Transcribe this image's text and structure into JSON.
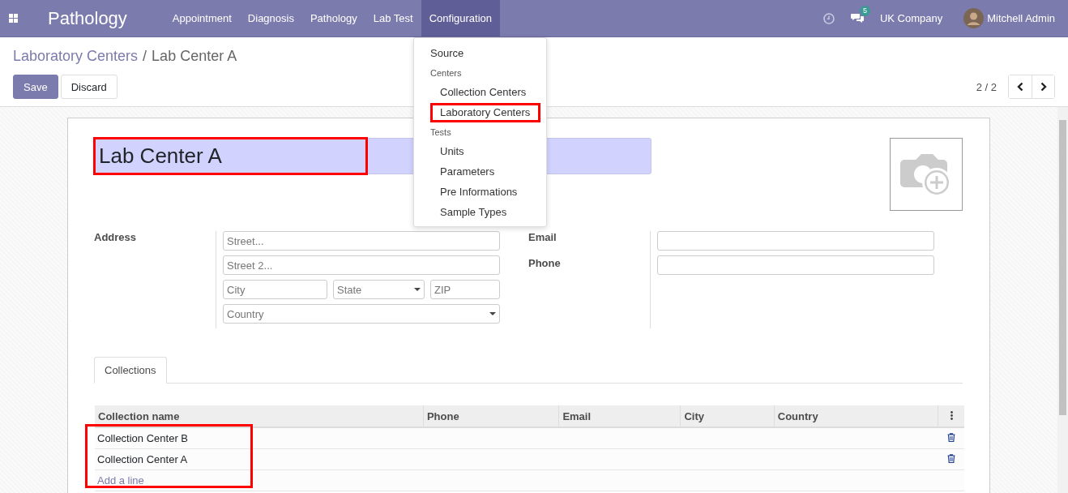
{
  "navbar": {
    "app_title": "Pathology",
    "menu": [
      {
        "label": "Appointment",
        "selected": false
      },
      {
        "label": "Diagnosis",
        "selected": false
      },
      {
        "label": "Pathology",
        "selected": false
      },
      {
        "label": "Lab Test",
        "selected": false
      },
      {
        "label": "Configuration",
        "selected": true
      }
    ],
    "messages_badge": "5",
    "company": "UK Company",
    "user": "Mitchell Admin"
  },
  "config_menu": {
    "items": [
      {
        "kind": "item",
        "label": "Source",
        "highlighted": false
      },
      {
        "kind": "header",
        "label": "Centers"
      },
      {
        "kind": "subitem",
        "label": "Collection Centers",
        "highlighted": false
      },
      {
        "kind": "subitem",
        "label": "Laboratory Centers",
        "highlighted": true
      },
      {
        "kind": "header",
        "label": "Tests"
      },
      {
        "kind": "subitem",
        "label": "Units",
        "highlighted": false
      },
      {
        "kind": "subitem",
        "label": "Parameters",
        "highlighted": false
      },
      {
        "kind": "subitem",
        "label": "Pre Informations",
        "highlighted": false
      },
      {
        "kind": "subitem",
        "label": "Sample Types",
        "highlighted": false
      }
    ]
  },
  "breadcrumb": {
    "parent": "Laboratory Centers",
    "separator": "/",
    "current": "Lab Center A"
  },
  "buttons": [
    {
      "label": "Save",
      "kind": "primary"
    },
    {
      "label": "Discard",
      "kind": "secondary"
    }
  ],
  "pager": "2 / 2",
  "form": {
    "name": {
      "value": "Lab Center A",
      "highlighted": true
    },
    "address": {
      "label": "Address",
      "street": {
        "placeholder": "Street..."
      },
      "street2": {
        "placeholder": "Street 2..."
      },
      "city": {
        "placeholder": "City"
      },
      "state": {
        "placeholder": "State"
      },
      "zip": {
        "placeholder": "ZIP"
      },
      "country": {
        "placeholder": "Country"
      }
    },
    "email": {
      "label": "Email"
    },
    "phone": {
      "label": "Phone"
    }
  },
  "tabs": [
    {
      "label": "Collections",
      "selected": true
    }
  ],
  "table": {
    "columns": [
      "Collection name",
      "Phone",
      "Email",
      "City",
      "Country"
    ],
    "rows": [
      {
        "collection_name": "Collection Center B"
      },
      {
        "collection_name": "Collection Center A"
      }
    ],
    "add_line": "Add a line",
    "highlighted": true
  }
}
